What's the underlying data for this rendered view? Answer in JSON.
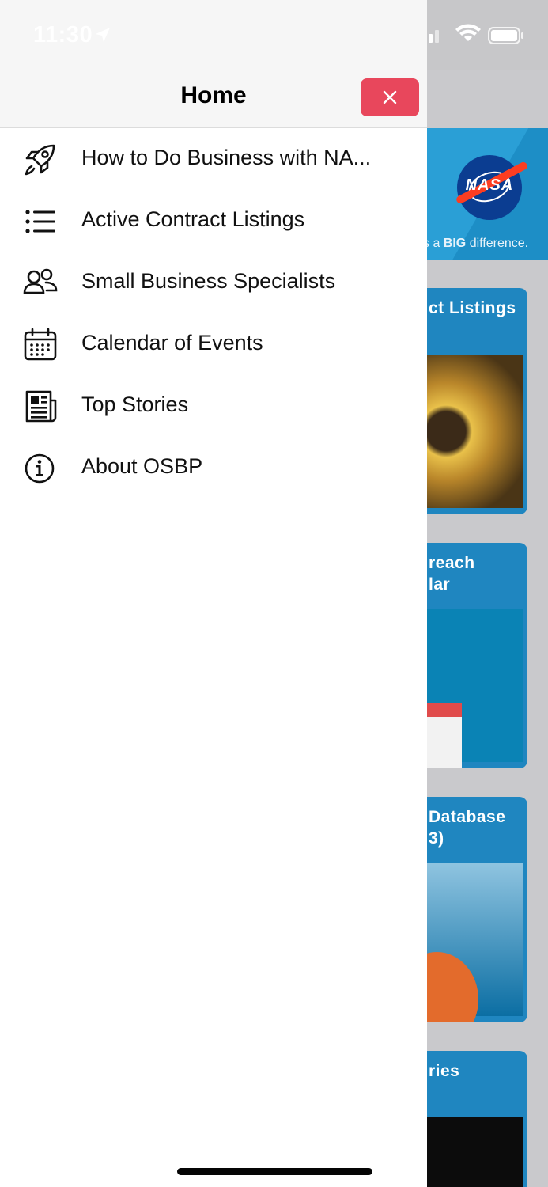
{
  "status_bar": {
    "time": "11:30"
  },
  "drawer": {
    "title": "Home",
    "items": [
      {
        "label": "How to Do Business with NA...",
        "icon": "rocket-icon"
      },
      {
        "label": "Active Contract Listings",
        "icon": "list-icon"
      },
      {
        "label": "Small Business Specialists",
        "icon": "people-icon"
      },
      {
        "label": "Calendar of Events",
        "icon": "calendar-icon"
      },
      {
        "label": "Top Stories",
        "icon": "newspaper-icon"
      },
      {
        "label": "About OSBP",
        "icon": "info-icon"
      }
    ]
  },
  "background": {
    "logo_text": "NASA",
    "tagline_prefix": "s a ",
    "tagline_bold": "BIG",
    "tagline_suffix": " difference.",
    "cards": [
      {
        "title": "ct Listings"
      },
      {
        "title_line1": "reach",
        "title_line2": "lar"
      },
      {
        "title_line1": "Database",
        "title_line2": "3)"
      },
      {
        "title": "ries"
      }
    ]
  },
  "colors": {
    "close_button": "#e8475c",
    "card_blue": "#1f86c0",
    "banner_blue": "#1d8ec6"
  }
}
